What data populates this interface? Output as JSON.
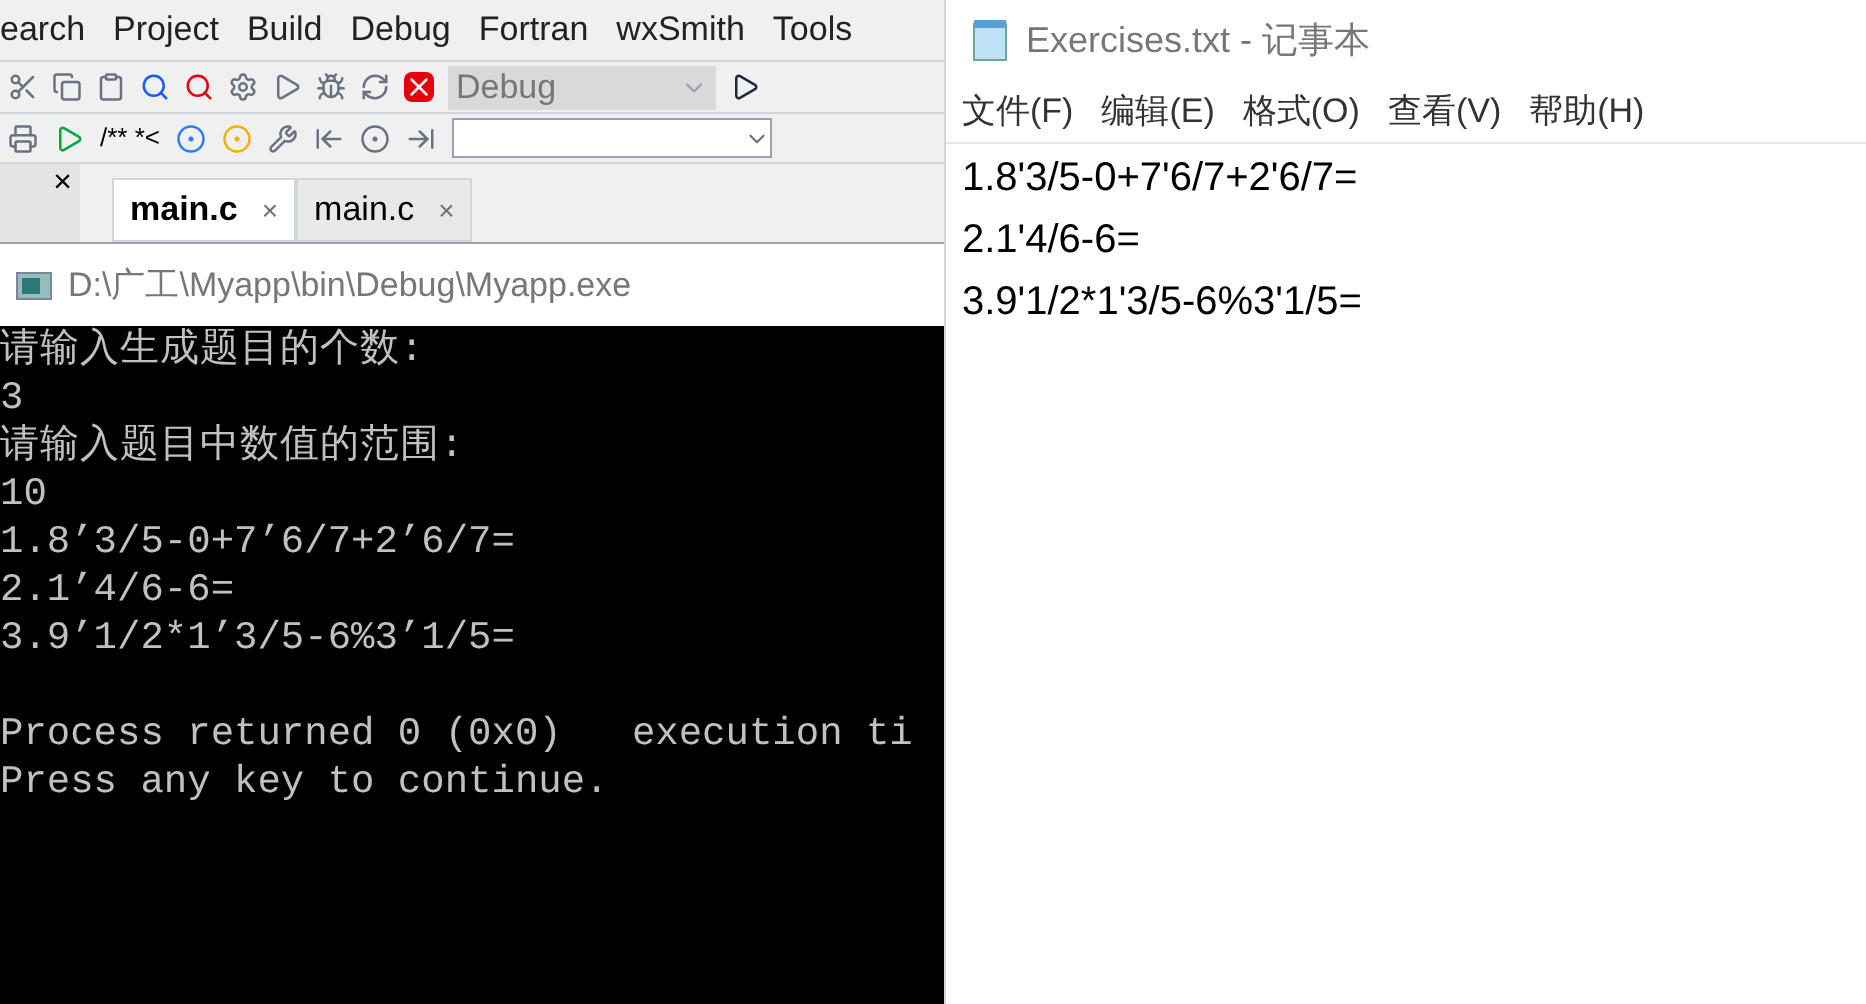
{
  "ide": {
    "menu": [
      "earch",
      "Project",
      "Build",
      "Debug",
      "Fortran",
      "wxSmith",
      "Tools"
    ],
    "build_target": "Debug",
    "comment_label": "/** *<",
    "panel_close": "×",
    "tabs": [
      {
        "label": "main.c",
        "selected": true,
        "close": "×"
      },
      {
        "label": "main.c",
        "selected": false,
        "close": "×"
      }
    ]
  },
  "console": {
    "title": "D:\\广工\\Myapp\\bin\\Debug\\Myapp.exe",
    "lines": [
      "请输入生成题目的个数:",
      "3",
      "请输入题目中数值的范围:",
      "10",
      "1.8’3/5-0+7’6/7+2’6/7=",
      "2.1’4/6-6=",
      "3.9’1/2*1’3/5-6%3’1/5="
    ],
    "status_lines": [
      "Process returned 0 (0x0)   execution ti",
      "Press any key to continue."
    ]
  },
  "notepad": {
    "title": "Exercises.txt - 记事本",
    "menu": [
      "文件(F)",
      "编辑(E)",
      "格式(O)",
      "查看(V)",
      "帮助(H)"
    ],
    "lines": [
      "1.8'3/5-0+7'6/7+2'6/7=",
      "2.1'4/6-6=",
      "3.9'1/2*1'3/5-6%3'1/5="
    ]
  }
}
